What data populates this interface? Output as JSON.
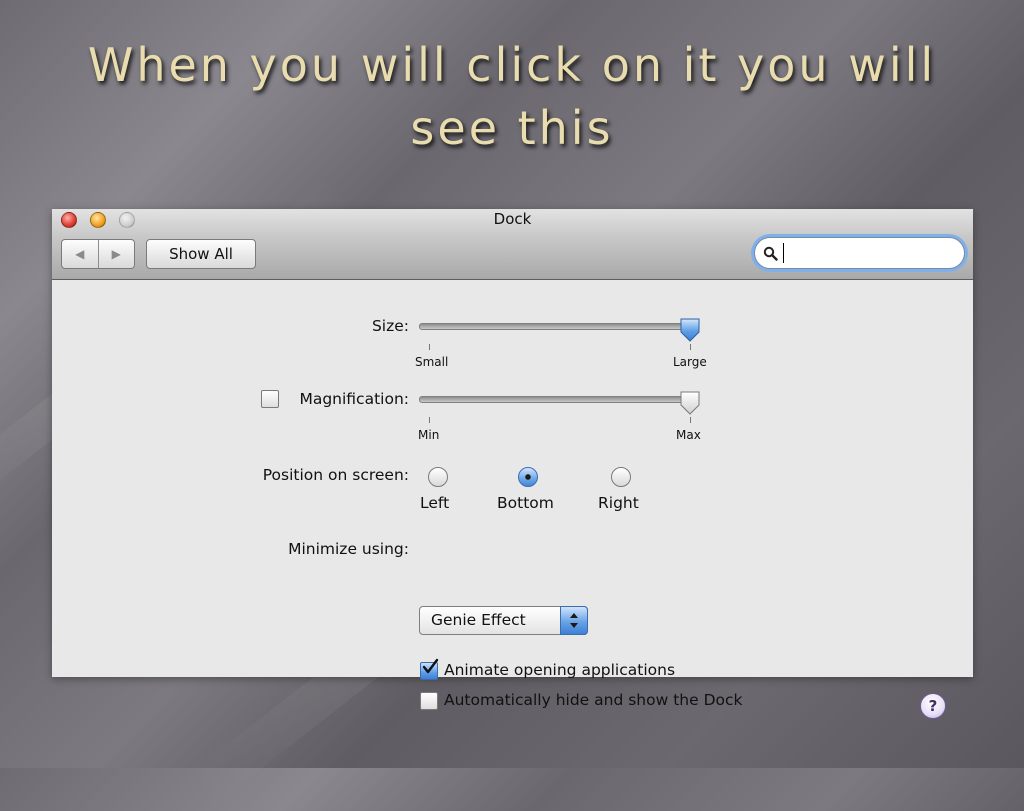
{
  "slide": {
    "title": "When you will click on it you will see this"
  },
  "window": {
    "title": "Dock",
    "toolbar": {
      "back_icon": "triangle-left",
      "forward_icon": "triangle-right",
      "show_all_label": "Show All",
      "search": {
        "value": "",
        "placeholder": ""
      }
    }
  },
  "dock": {
    "size": {
      "label": "Size:",
      "min_label": "Small",
      "max_label": "Large",
      "value": 1.0
    },
    "magnification": {
      "label": "Magnification:",
      "checked": false,
      "min_label": "Min",
      "max_label": "Max",
      "value": 1.0
    },
    "position": {
      "label": "Position on screen:",
      "options": [
        "Left",
        "Bottom",
        "Right"
      ],
      "selected": "Bottom"
    },
    "minimize": {
      "label": "Minimize using:",
      "selected": "Genie Effect"
    },
    "animate": {
      "label": "Animate opening applications",
      "checked": true
    },
    "autohide": {
      "label": "Automatically hide and show the Dock",
      "checked": false
    },
    "help_label": "?"
  },
  "colors": {
    "title_text": "#e9dcae",
    "accent_blue": "#5f9ee6",
    "window_bg": "#e8e8e8"
  }
}
